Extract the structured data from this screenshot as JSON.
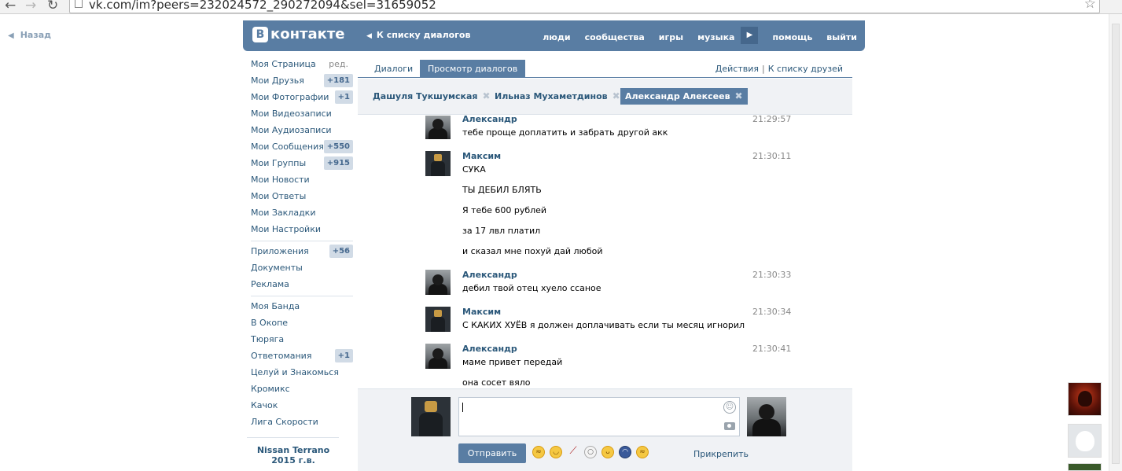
{
  "browser": {
    "url": "vk.com/im?peers=232024572_290272094&sel=31659052"
  },
  "back_link": "Назад",
  "header": {
    "logo_letter": "В",
    "logo_text": "контакте",
    "back_to_dialogs": "К списку диалогов",
    "nav": [
      "люди",
      "сообщества",
      "игры",
      "музыка",
      "помощь",
      "выйти"
    ]
  },
  "left_menu": {
    "edit_label": "ред.",
    "group1": [
      {
        "label": "Моя Страница",
        "badge": ""
      },
      {
        "label": "Мои Друзья",
        "badge": "+181"
      },
      {
        "label": "Мои Фотографии",
        "badge": "+1"
      },
      {
        "label": "Мои Видеозаписи",
        "badge": ""
      },
      {
        "label": "Мои Аудиозаписи",
        "badge": ""
      },
      {
        "label": "Мои Сообщения",
        "badge": "+550"
      },
      {
        "label": "Мои Группы",
        "badge": "+915"
      },
      {
        "label": "Мои Новости",
        "badge": ""
      },
      {
        "label": "Мои Ответы",
        "badge": ""
      },
      {
        "label": "Мои Закладки",
        "badge": ""
      },
      {
        "label": "Мои Настройки",
        "badge": ""
      }
    ],
    "group2": [
      {
        "label": "Приложения",
        "badge": "+56"
      },
      {
        "label": "Документы",
        "badge": ""
      },
      {
        "label": "Реклама",
        "badge": ""
      }
    ],
    "group3": [
      {
        "label": "Моя Банда",
        "badge": ""
      },
      {
        "label": "В Окопе",
        "badge": ""
      },
      {
        "label": "Тюряга",
        "badge": ""
      },
      {
        "label": "Ответомания",
        "badge": "+1"
      },
      {
        "label": "Целуй и Знакомься",
        "badge": ""
      },
      {
        "label": "Кромикс",
        "badge": ""
      },
      {
        "label": "Качок",
        "badge": ""
      },
      {
        "label": "Лига Скорости",
        "badge": ""
      }
    ],
    "ad_text": "Nissan Terrano 2015 г.в."
  },
  "tabs": {
    "dialogs": "Диалоги",
    "view_dialogs": "Просмотр диалогов",
    "actions": "Действия",
    "separator": "|",
    "to_friends": "К списку друзей"
  },
  "peers": [
    {
      "name": "Дашуля Тукшумская",
      "active": false
    },
    {
      "name": "Ильназ Мухаметдинов",
      "active": false
    },
    {
      "name": "Александр Алексеев",
      "active": true
    }
  ],
  "messages": [
    {
      "author": "Александр",
      "time": "21:29:57",
      "avatar": "dark",
      "lines": [
        "тебе проще доплатить и забрать другой акк"
      ]
    },
    {
      "author": "Максим",
      "time": "21:30:11",
      "avatar": "cat",
      "lines": [
        "СУКА",
        "ТЫ ДЕБИЛ БЛЯТЬ",
        "Я тебе 600 рублей",
        "за 17 лвл платил",
        "и сказал мне похуй дай любой"
      ]
    },
    {
      "author": "Александр",
      "time": "21:30:33",
      "avatar": "dark",
      "lines": [
        "дебил твой отец хуело ссаное"
      ]
    },
    {
      "author": "Максим",
      "time": "21:30:34",
      "avatar": "cat",
      "lines": [
        "С КАКИХ ХУЁВ я должен доплачивать если ты месяц игнорил"
      ]
    },
    {
      "author": "Александр",
      "time": "21:30:41",
      "avatar": "dark",
      "lines": [
        "маме привет передай",
        "она сосет вяло"
      ]
    }
  ],
  "composer": {
    "send_label": "Отправить",
    "attach_label": "Прикрепить",
    "emoji_icons": [
      "laughing-tears",
      "blushing",
      "syringe",
      "ghost",
      "tongue-out",
      "police",
      "laughing-tears"
    ]
  }
}
